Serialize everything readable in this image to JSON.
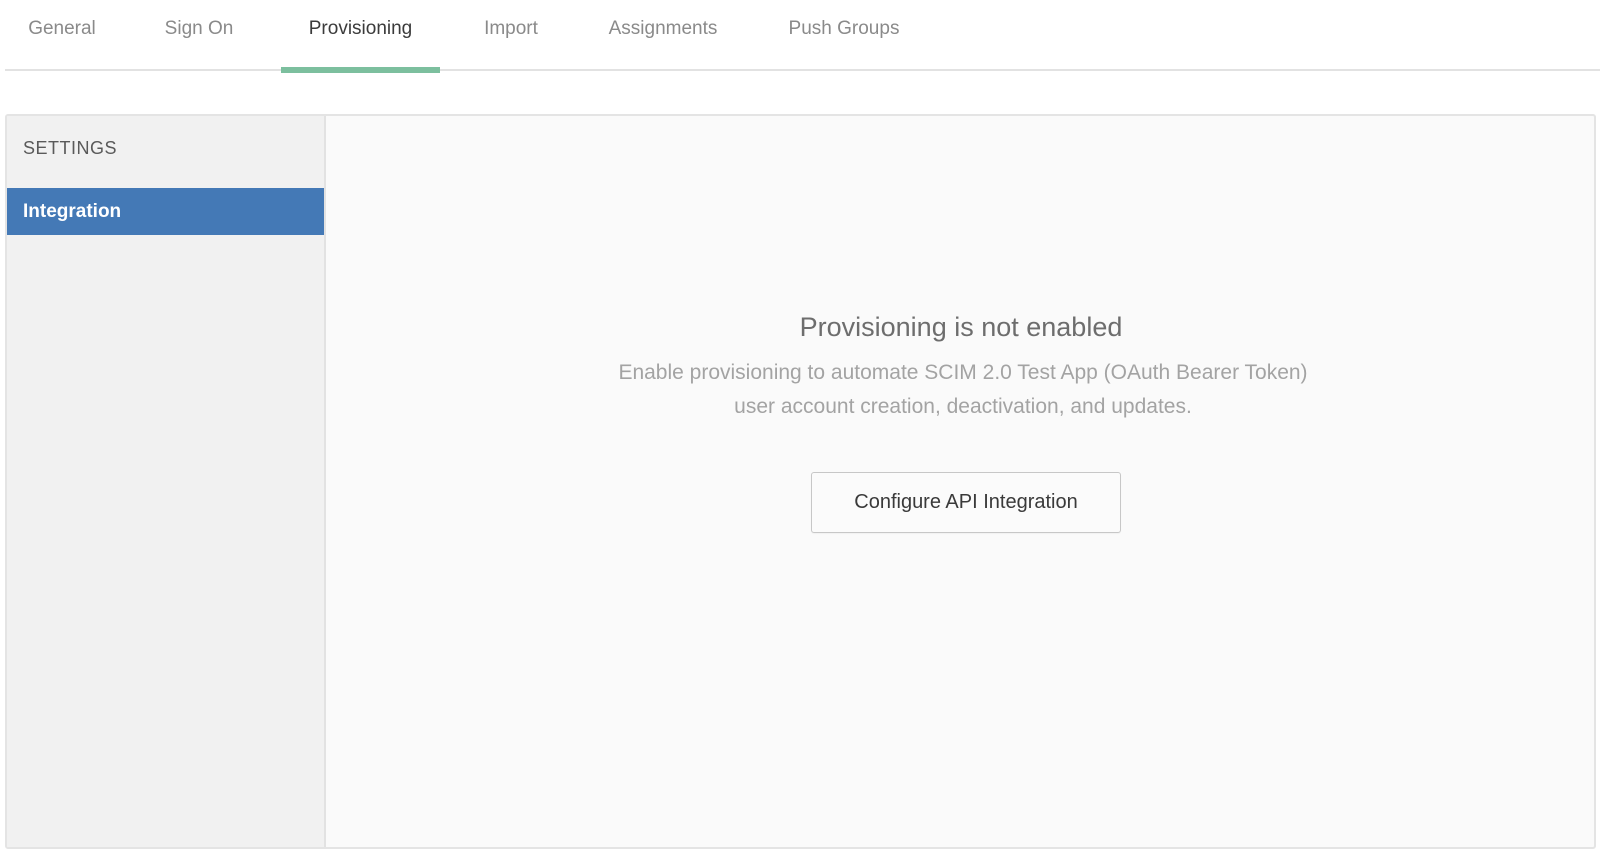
{
  "tabs": [
    {
      "label": "General"
    },
    {
      "label": "Sign On"
    },
    {
      "label": "Provisioning",
      "active": true
    },
    {
      "label": "Import"
    },
    {
      "label": "Assignments"
    },
    {
      "label": "Push Groups"
    }
  ],
  "sidebar": {
    "heading": "SETTINGS",
    "items": [
      {
        "label": "Integration",
        "selected": true
      }
    ]
  },
  "main": {
    "empty_state": {
      "title": "Provisioning is not enabled",
      "description": "Enable provisioning to automate SCIM 2.0 Test App (OAuth Bearer Token) user account creation, deactivation, and updates.",
      "button_label": "Configure API Integration"
    }
  },
  "colors": {
    "active_tab_underline": "#7cbf9e",
    "selected_sidebar_item": "#4479b6"
  }
}
